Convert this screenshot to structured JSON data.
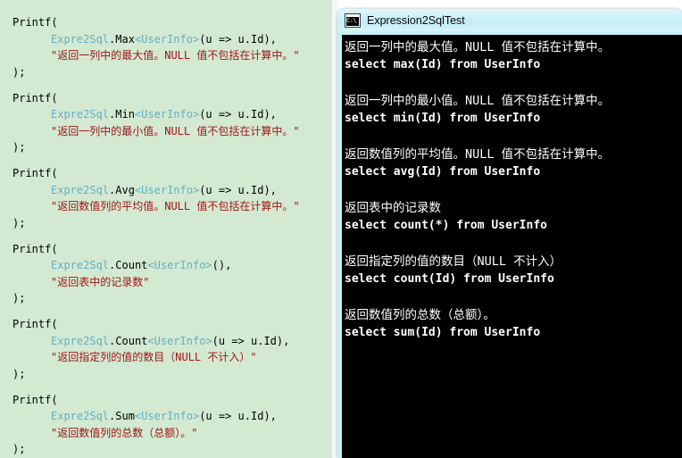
{
  "theme": {
    "code_background": "#d3e9d2",
    "console_background": "#000000",
    "console_text": "#ffffff",
    "window_frame": "#c8f0f8",
    "token_type_color": "#63b0c4",
    "token_string_color": "#a31515",
    "token_plain_color": "#000000"
  },
  "code_pane": {
    "name": "source-code-pane",
    "language": "csharp",
    "blocks": [
      {
        "open": "Printf(",
        "call_prefix": "Expre2Sql",
        "call_dot": ".",
        "call_method": "Max",
        "call_generic": "<UserInfo>",
        "call_args": "(u => u.Id),",
        "string_literal": "\"返回一列中的最大值。NULL 值不包括在计算中。\"",
        "close": ");"
      },
      {
        "open": "Printf(",
        "call_prefix": "Expre2Sql",
        "call_dot": ".",
        "call_method": "Min",
        "call_generic": "<UserInfo>",
        "call_args": "(u => u.Id),",
        "string_literal": "\"返回一列中的最小值。NULL 值不包括在计算中。\"",
        "close": ");"
      },
      {
        "open": "Printf(",
        "call_prefix": "Expre2Sql",
        "call_dot": ".",
        "call_method": "Avg",
        "call_generic": "<UserInfo>",
        "call_args": "(u => u.Id),",
        "string_literal": "\"返回数值列的平均值。NULL 值不包括在计算中。\"",
        "close": ");"
      },
      {
        "open": "Printf(",
        "call_prefix": "Expre2Sql",
        "call_dot": ".",
        "call_method": "Count",
        "call_generic": "<UserInfo>",
        "call_args": "(),",
        "string_literal": "\"返回表中的记录数\"",
        "close": ");"
      },
      {
        "open": "Printf(",
        "call_prefix": "Expre2Sql",
        "call_dot": ".",
        "call_method": "Count",
        "call_generic": "<UserInfo>",
        "call_args": "(u => u.Id),",
        "string_literal": "\"返回指定列的值的数目（NULL 不计入）\"",
        "close": ");"
      },
      {
        "open": "Printf(",
        "call_prefix": "Expre2Sql",
        "call_dot": ".",
        "call_method": "Sum",
        "call_generic": "<UserInfo>",
        "call_args": "(u => u.Id),",
        "string_literal": "\"返回数值列的总数（总额）。\"",
        "close": ");"
      }
    ]
  },
  "console_window": {
    "title": "Expression2SqlTest",
    "icon": "console-cmd-icon",
    "output": [
      {
        "description": "返回一列中的最大值。NULL 值不包括在计算中。",
        "sql": "select max(Id) from UserInfo"
      },
      {
        "description": "返回一列中的最小值。NULL 值不包括在计算中。",
        "sql": "select min(Id) from UserInfo"
      },
      {
        "description": "返回数值列的平均值。NULL 值不包括在计算中。",
        "sql": "select avg(Id) from UserInfo"
      },
      {
        "description": "返回表中的记录数",
        "sql": "select count(*) from UserInfo"
      },
      {
        "description": "返回指定列的值的数目（NULL 不计入）",
        "sql": "select count(Id) from UserInfo"
      },
      {
        "description": "返回数值列的总数（总额）。",
        "sql": "select sum(Id) from UserInfo"
      }
    ]
  }
}
